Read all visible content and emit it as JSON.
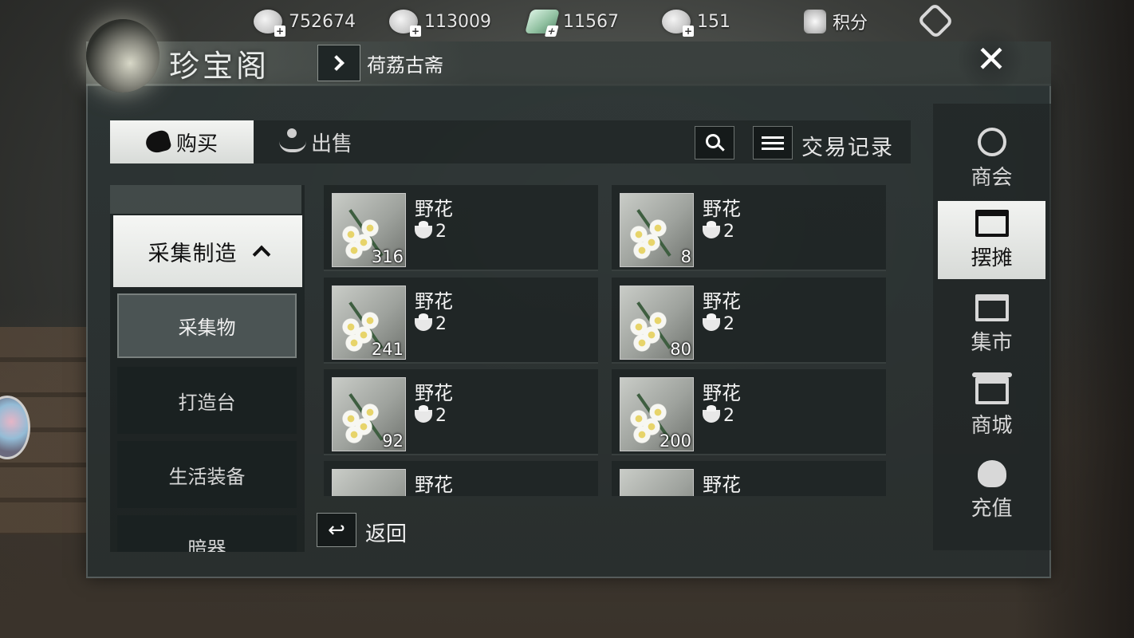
{
  "currencies": [
    {
      "icon": "silver-coin-icon",
      "value": "752674"
    },
    {
      "icon": "silver-ingot-icon",
      "value": "113009"
    },
    {
      "icon": "jade-icon",
      "value": "11567"
    },
    {
      "icon": "gold-ingot-icon",
      "value": "151"
    }
  ],
  "score": {
    "label": "积分"
  },
  "header": {
    "title": "珍宝阁",
    "location": "荷荔古斋"
  },
  "tabs": {
    "buy": "购买",
    "sell": "出售"
  },
  "toolbar": {
    "record_label": "交易记录"
  },
  "categories": {
    "main": "采集制造",
    "selected_sub": "采集物",
    "others": [
      "打造台",
      "生活装备",
      "暗器"
    ]
  },
  "items": [
    {
      "name": "野花",
      "price": "2",
      "qty": "316"
    },
    {
      "name": "野花",
      "price": "2",
      "qty": "8"
    },
    {
      "name": "野花",
      "price": "2",
      "qty": "241"
    },
    {
      "name": "野花",
      "price": "2",
      "qty": "80"
    },
    {
      "name": "野花",
      "price": "2",
      "qty": "92"
    },
    {
      "name": "野花",
      "price": "2",
      "qty": "200"
    },
    {
      "name": "野花",
      "price": "",
      "qty": ""
    },
    {
      "name": "野花",
      "price": "",
      "qty": ""
    }
  ],
  "back": {
    "label": "返回"
  },
  "right_nav": [
    "商会",
    "摆摊",
    "集市",
    "商城",
    "充值"
  ],
  "right_nav_active": "摆摊",
  "colors": {
    "panel": "#2c3434",
    "active_tab": "#f2f3f1",
    "text": "#e8e8e8"
  }
}
